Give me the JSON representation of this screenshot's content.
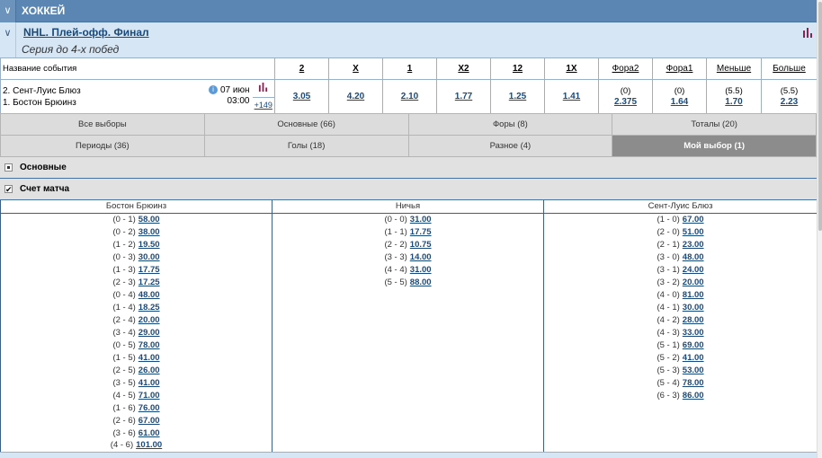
{
  "sport": {
    "title": "ХОККЕЙ",
    "toggle": "∨"
  },
  "event": {
    "toggle": "∨",
    "name": "NHL. Плей-офф. Финал",
    "subtitle": "Серия до 4-х побед"
  },
  "market": {
    "event_col": "Название события",
    "columns": [
      "2",
      "X",
      "1",
      "X2",
      "12",
      "1X",
      "Фора2",
      "Фора1",
      "Меньше",
      "Больше"
    ],
    "team1": "2. Сент-Луис Блюз",
    "team2": "1. Бостон Брюинз",
    "info_icon": "i",
    "date": "07 июн",
    "time": "03:00",
    "more": "+149",
    "odds": [
      "3.05",
      "4.20",
      "2.10",
      "1.77",
      "1.25",
      "1.41"
    ],
    "handicaps": [
      {
        "param": "(0)",
        "odd": "2.375"
      },
      {
        "param": "(0)",
        "odd": "1.64"
      },
      {
        "param": "(5.5)",
        "odd": "1.70"
      },
      {
        "param": "(5.5)",
        "odd": "2.23"
      }
    ]
  },
  "tabs": {
    "row1": [
      "Все выборы",
      "Основные (66)",
      "Форы (8)",
      "Тоталы (20)"
    ],
    "row2": [
      "Периоды (36)",
      "Голы (18)",
      "Разное (4)",
      "Мой выбор (1)"
    ]
  },
  "sections": {
    "main": "Основные",
    "score": "Счет матча"
  },
  "scores": {
    "headers": [
      "Бостон Брюинз",
      "Ничья",
      "Сент-Луис Блюз"
    ],
    "rows": [
      [
        [
          "(0 - 1)",
          "58.00"
        ],
        [
          "(0 - 0)",
          "31.00"
        ],
        [
          "(1 - 0)",
          "67.00"
        ]
      ],
      [
        [
          "(0 - 2)",
          "38.00"
        ],
        [
          "(1 - 1)",
          "17.75"
        ],
        [
          "(2 - 0)",
          "51.00"
        ]
      ],
      [
        [
          "(1 - 2)",
          "19.50"
        ],
        [
          "(2 - 2)",
          "10.75"
        ],
        [
          "(2 - 1)",
          "23.00"
        ]
      ],
      [
        [
          "(0 - 3)",
          "30.00"
        ],
        [
          "(3 - 3)",
          "14.00"
        ],
        [
          "(3 - 0)",
          "48.00"
        ]
      ],
      [
        [
          "(1 - 3)",
          "17.75"
        ],
        [
          "(4 - 4)",
          "31.00"
        ],
        [
          "(3 - 1)",
          "24.00"
        ]
      ],
      [
        [
          "(2 - 3)",
          "17.25"
        ],
        [
          "(5 - 5)",
          "88.00"
        ],
        [
          "(3 - 2)",
          "20.00"
        ]
      ],
      [
        [
          "(0 - 4)",
          "48.00"
        ],
        null,
        [
          "(4 - 0)",
          "81.00"
        ]
      ],
      [
        [
          "(1 - 4)",
          "18.25"
        ],
        null,
        [
          "(4 - 1)",
          "30.00"
        ]
      ],
      [
        [
          "(2 - 4)",
          "20.00"
        ],
        null,
        [
          "(4 - 2)",
          "28.00"
        ]
      ],
      [
        [
          "(3 - 4)",
          "29.00"
        ],
        null,
        [
          "(4 - 3)",
          "33.00"
        ]
      ],
      [
        [
          "(0 - 5)",
          "78.00"
        ],
        null,
        [
          "(5 - 1)",
          "69.00"
        ]
      ],
      [
        [
          "(1 - 5)",
          "41.00"
        ],
        null,
        [
          "(5 - 2)",
          "41.00"
        ]
      ],
      [
        [
          "(2 - 5)",
          "26.00"
        ],
        null,
        [
          "(5 - 3)",
          "53.00"
        ]
      ],
      [
        [
          "(3 - 5)",
          "41.00"
        ],
        null,
        [
          "(5 - 4)",
          "78.00"
        ]
      ],
      [
        [
          "(4 - 5)",
          "71.00"
        ],
        null,
        [
          "(6 - 3)",
          "86.00"
        ]
      ],
      [
        [
          "(1 - 6)",
          "76.00"
        ],
        null,
        null
      ],
      [
        [
          "(2 - 6)",
          "67.00"
        ],
        null,
        null
      ],
      [
        [
          "(3 - 6)",
          "61.00"
        ],
        null,
        null
      ],
      [
        [
          "(4 - 6)",
          "101.00"
        ],
        null,
        null
      ]
    ]
  },
  "colors": {
    "header": "#5b86b3",
    "link": "#1a4a7c",
    "active_tab": "#8c8c8c"
  }
}
